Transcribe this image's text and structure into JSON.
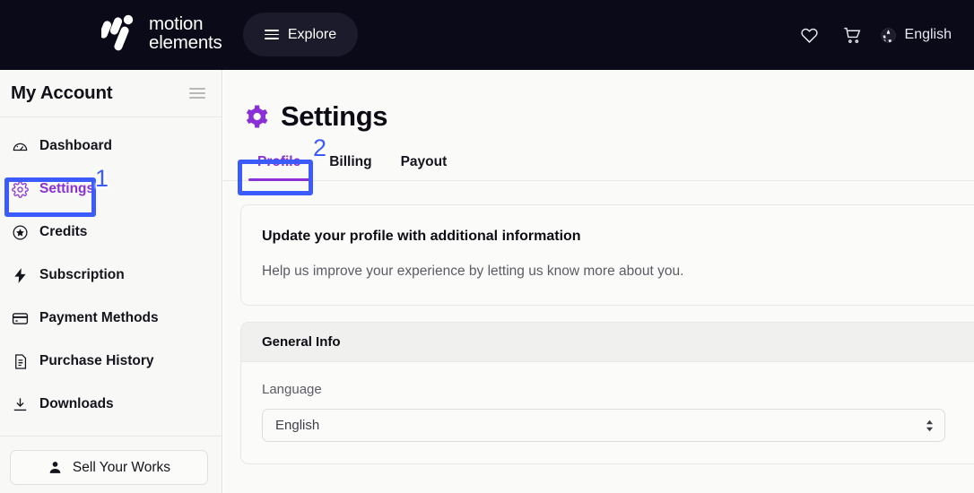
{
  "header": {
    "logo": {
      "line1": "motion",
      "line2": "elements",
      "icon": "motion-elements-logo-icon"
    },
    "explore_label": "Explore",
    "menu_icon": "hamburger-menu-icon",
    "icons": [
      {
        "name": "wishlist-heart-icon",
        "glyph": "heart"
      },
      {
        "name": "shopping-cart-icon",
        "glyph": "cart"
      }
    ],
    "language": {
      "label": "English",
      "icon": "globe-icon"
    }
  },
  "sidebar": {
    "title": "My Account",
    "collapse_icon": "hamburger-menu-icon",
    "items": [
      {
        "label": "Dashboard",
        "icon": "dashboard-gauge-icon",
        "active": false
      },
      {
        "label": "Settings",
        "icon": "gear-icon",
        "active": true
      },
      {
        "label": "Credits",
        "icon": "star-circle-icon",
        "active": false
      },
      {
        "label": "Subscription",
        "icon": "lightning-bolt-icon",
        "active": false
      },
      {
        "label": "Payment Methods",
        "icon": "credit-card-icon",
        "active": false
      },
      {
        "label": "Purchase History",
        "icon": "document-list-icon",
        "active": false
      },
      {
        "label": "Downloads",
        "icon": "download-icon",
        "active": false
      }
    ],
    "sell_button": {
      "label": "Sell Your Works",
      "icon": "user-person-icon"
    }
  },
  "main": {
    "page_title": "Settings",
    "page_title_icon": "gear-icon",
    "tabs": [
      {
        "label": "Profile",
        "active": true
      },
      {
        "label": "Billing",
        "active": false
      },
      {
        "label": "Payout",
        "active": false
      }
    ],
    "info_card": {
      "heading": "Update your profile with additional information",
      "subtext": "Help us improve your experience by letting us know more about you."
    },
    "general_info": {
      "section_title": "General Info",
      "language_field": {
        "label": "Language",
        "value": "English"
      }
    }
  },
  "annotations": [
    {
      "number": "1",
      "target": "sidebar-item-settings"
    },
    {
      "number": "2",
      "target": "tab-profile"
    }
  ],
  "colors": {
    "topbar_bg": "#0a0a18",
    "accent_purple": "#8b2fd6",
    "annotation_blue": "#3b5bfd",
    "sidebar_bg": "#f8f8f7",
    "main_bg": "#fafaf9"
  }
}
